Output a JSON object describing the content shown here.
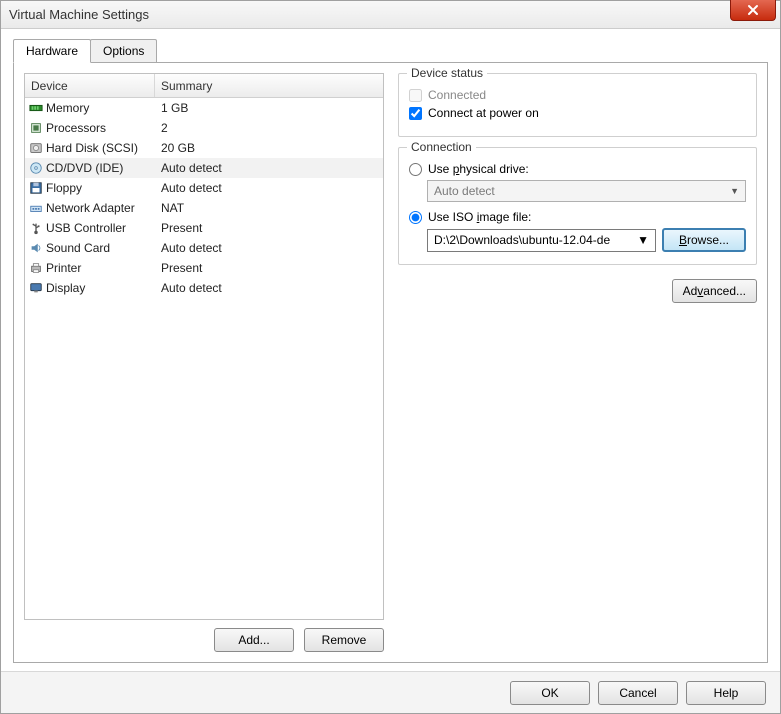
{
  "window": {
    "title": "Virtual Machine Settings"
  },
  "tabs": {
    "hardware": "Hardware",
    "options": "Options"
  },
  "columns": {
    "device": "Device",
    "summary": "Summary"
  },
  "devices": [
    {
      "name": "Memory",
      "summary": "1 GB",
      "icon": "memory"
    },
    {
      "name": "Processors",
      "summary": "2",
      "icon": "cpu"
    },
    {
      "name": "Hard Disk (SCSI)",
      "summary": "20 GB",
      "icon": "hdd"
    },
    {
      "name": "CD/DVD (IDE)",
      "summary": "Auto detect",
      "icon": "cd",
      "selected": true
    },
    {
      "name": "Floppy",
      "summary": "Auto detect",
      "icon": "floppy"
    },
    {
      "name": "Network Adapter",
      "summary": "NAT",
      "icon": "net"
    },
    {
      "name": "USB Controller",
      "summary": "Present",
      "icon": "usb"
    },
    {
      "name": "Sound Card",
      "summary": "Auto detect",
      "icon": "sound"
    },
    {
      "name": "Printer",
      "summary": "Present",
      "icon": "printer"
    },
    {
      "name": "Display",
      "summary": "Auto detect",
      "icon": "display"
    }
  ],
  "buttons": {
    "add": "Add...",
    "remove": "Remove",
    "ok": "OK",
    "cancel": "Cancel",
    "help": "Help",
    "browse": "Browse...",
    "advanced": "Advanced..."
  },
  "status_group": {
    "title": "Device status",
    "connected": "Connected",
    "connect_power": "Connect at power on"
  },
  "connection_group": {
    "title": "Connection",
    "physical": "Use physical drive:",
    "physical_value": "Auto detect",
    "iso": "Use ISO image file:",
    "iso_value": "D:\\2\\Downloads\\ubuntu-12.04-de"
  }
}
